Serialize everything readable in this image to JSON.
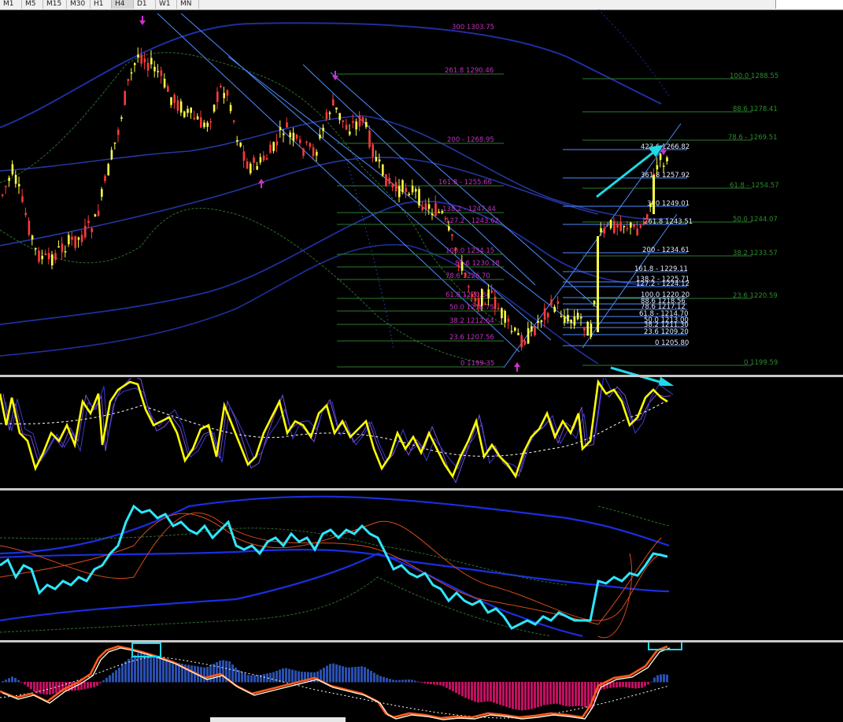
{
  "toolbar": {
    "timeframes": [
      "M1",
      "M5",
      "M15",
      "M30",
      "H1",
      "H4",
      "D1",
      "W1",
      "MN"
    ]
  },
  "colors": {
    "background": "#000000",
    "fib_major": "#cc33cc",
    "fib_minor": "#4d8cff",
    "fib_green": "#2e8b2e",
    "cyan_arrow": "#20d8e8",
    "bollinger": "#1f2f9f",
    "oscillator": "#ffff00",
    "histogram_up": "#2a4fb0",
    "histogram_down": "#c01060"
  },
  "fib_left": [
    {
      "label": "300 1303.75"
    },
    {
      "label": "261.8 1290.46"
    },
    {
      "label": "200 - 1268.95"
    },
    {
      "label": "161.8 - 1255.66"
    },
    {
      "label": "138.2 - 1247.44"
    },
    {
      "label": "127.2 - 1243.62"
    },
    {
      "label": "100.0 1234.15"
    },
    {
      "label": "88.6 1230.18"
    },
    {
      "label": "78.6 1226.70"
    },
    {
      "label": "61.8 1220.84"
    },
    {
      "label": "50.0 1216.75"
    },
    {
      "label": "38.2 1212.64"
    },
    {
      "label": "23.6 1207.56"
    },
    {
      "label": "0 1199.35"
    }
  ],
  "fib_right": [
    {
      "label": "100.0 1288.55"
    },
    {
      "label": "88.6 1278.41"
    },
    {
      "label": "78.6 - 1269.51"
    },
    {
      "label": "61.8 - 1254.57"
    },
    {
      "label": "50.0 1244.07"
    },
    {
      "label": "38.2 1233.57"
    },
    {
      "label": "23.6 1220.59"
    },
    {
      "label": "0 1199.59"
    }
  ],
  "fib_blue": [
    {
      "label": "423.6 1266.82"
    },
    {
      "label": "361.8 1257.92"
    },
    {
      "label": "300 1249.01"
    },
    {
      "label": "261.8 1243.51"
    },
    {
      "label": "200 - 1234.61"
    },
    {
      "label": "161.8 - 1229.11"
    },
    {
      "label": "138.2 - 1225.71"
    },
    {
      "label": "127.2 - 1224.12"
    },
    {
      "label": "100.0 1220.20"
    },
    {
      "label": "88.6 1218.56"
    },
    {
      "label": "78.6 1217.12"
    },
    {
      "label": "61.8 - 1214.70"
    },
    {
      "label": "50.0 1213.00"
    },
    {
      "label": "38.2 1211.30"
    },
    {
      "label": "23.6 1209.20"
    },
    {
      "label": "0 1205.80"
    }
  ]
}
